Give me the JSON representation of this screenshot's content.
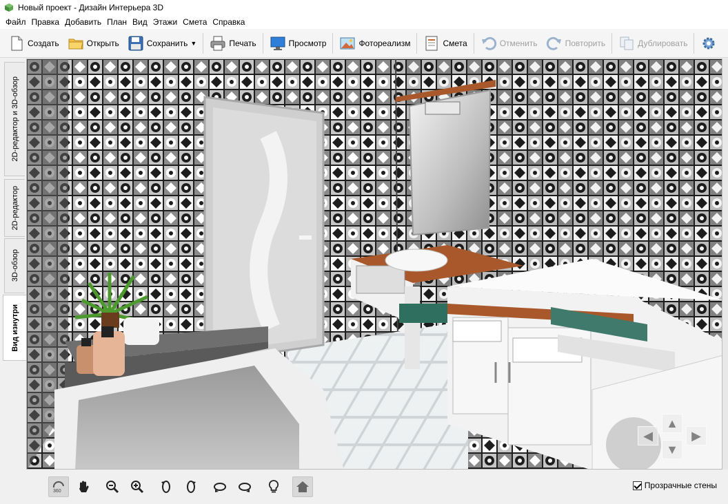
{
  "window": {
    "title": "Новый проект - Дизайн Интерьера 3D"
  },
  "menu": [
    "Файл",
    "Правка",
    "Добавить",
    "План",
    "Вид",
    "Этажи",
    "Смета",
    "Справка"
  ],
  "toolbar": {
    "create": "Создать",
    "open": "Открыть",
    "save": "Сохранить",
    "print": "Печать",
    "preview": "Просмотр",
    "photoreal": "Фотореализм",
    "estimate": "Смета",
    "undo": "Отменить",
    "redo": "Повторить",
    "duplicate": "Дублировать"
  },
  "side_tabs": [
    "2D-редактор и 3D-обзор",
    "2D-редактор",
    "3D-обзор",
    "Вид изнутри"
  ],
  "active_side_tab": "Вид изнутри",
  "bottom": {
    "rotate_360_label": "360",
    "transparent_walls_label": "Прозрачные стены",
    "transparent_walls_checked": true
  },
  "scene": {
    "type": "3d-bathroom-interior",
    "tile_colors": [
      "#1e1e1e",
      "#ffffff",
      "#8a8a8a",
      "#c6c6c6"
    ],
    "wood_color": "#a8582a"
  },
  "colors": {
    "accent_disabled": "#a0a0a0",
    "vanity_white": "#f2f2f2",
    "towel_green": "#3f7a6c"
  }
}
